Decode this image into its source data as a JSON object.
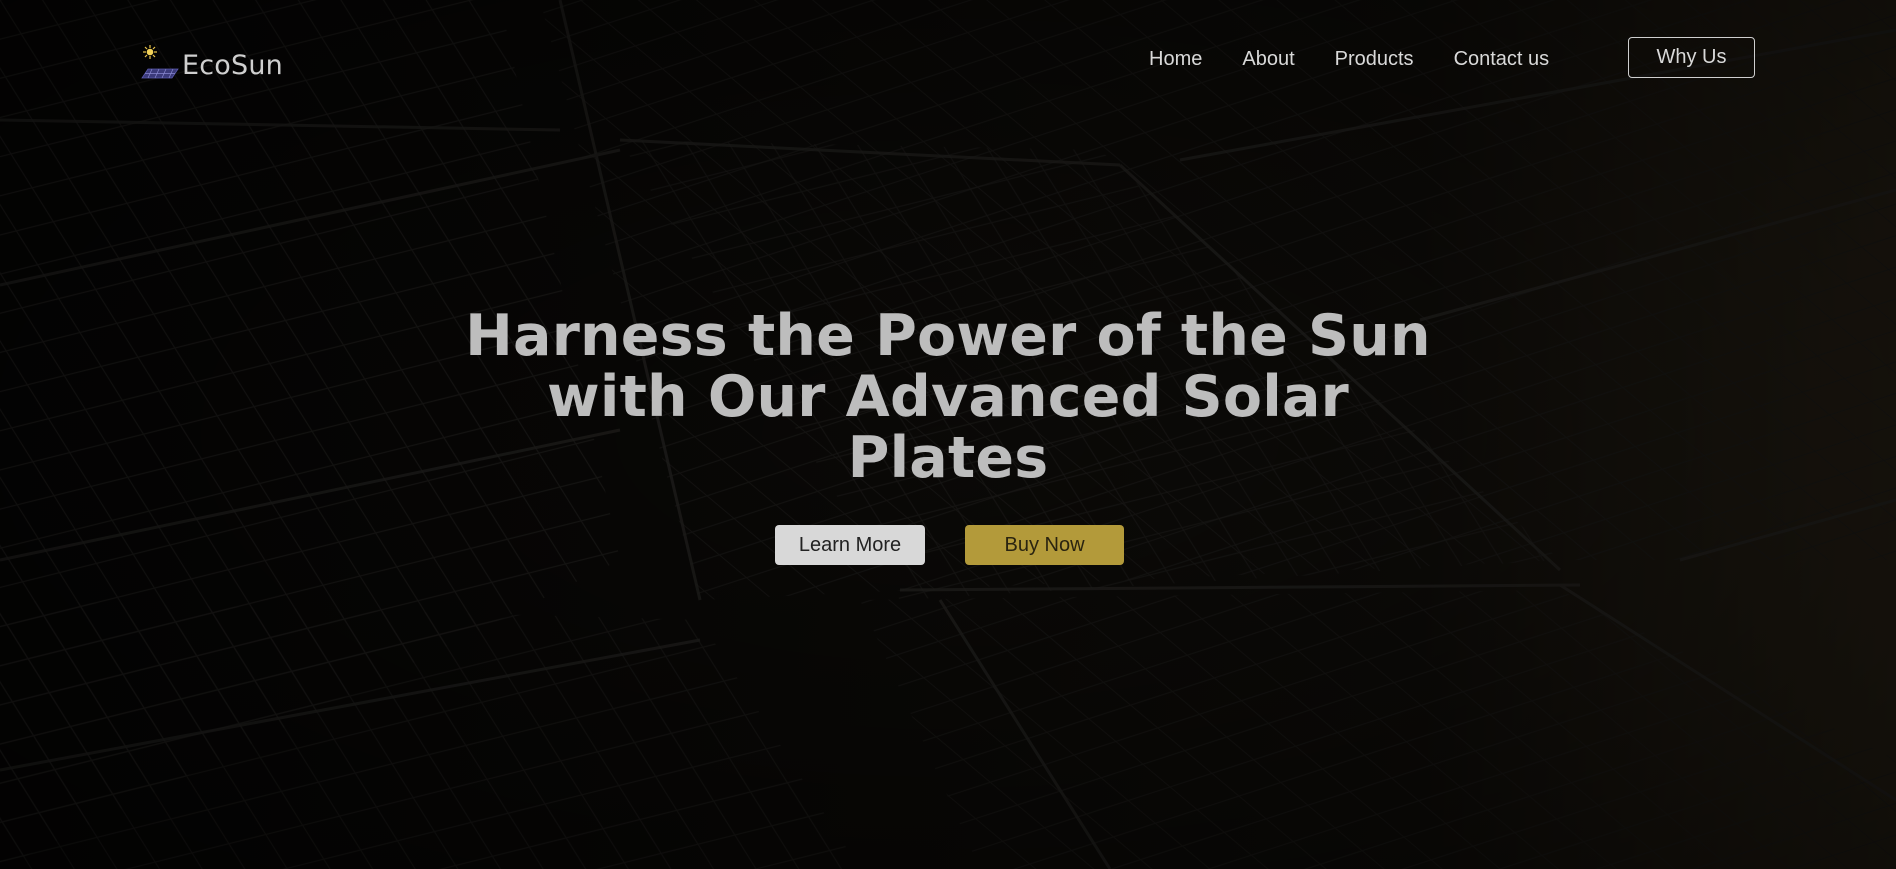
{
  "brand": {
    "name": "EcoSun",
    "logo_icon": "sun-over-solar-panel-icon"
  },
  "nav": {
    "links": [
      {
        "label": "Home"
      },
      {
        "label": "About"
      },
      {
        "label": "Products"
      },
      {
        "label": "Contact us"
      }
    ],
    "cta_label": "Why Us"
  },
  "hero": {
    "headline": "Harness the Power of the Sun with Our Advanced Solar Plates",
    "learn_more_label": "Learn More",
    "buy_now_label": "Buy Now",
    "background_image": "solar-panels-photo"
  },
  "colors": {
    "accent_gold": "#b39a3a",
    "headline_text": "#bdbdbd",
    "light_button": "#d8d8d8",
    "overlay": "#050505"
  }
}
